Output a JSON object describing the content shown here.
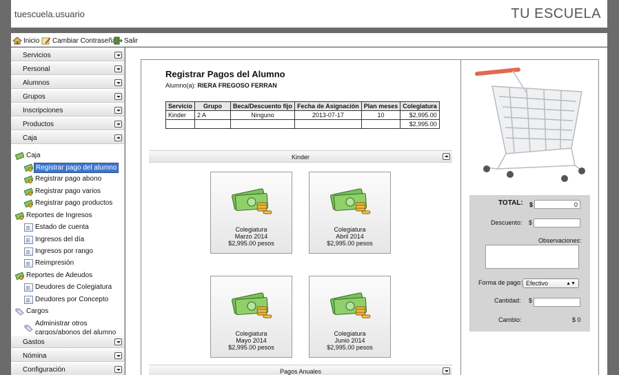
{
  "header": {
    "user": "tuescuela.usuario",
    "brand": "TU ESCUELA"
  },
  "toolbar": {
    "home": "Inicio",
    "change_password": "Cambiar Contraseña",
    "logout": "Salir"
  },
  "sidebar": {
    "sections": [
      "Servicios",
      "Personal",
      "Alumnos",
      "Grupos",
      "Inscripciones",
      "Productos",
      "Caja"
    ],
    "tree": {
      "caja": "Caja",
      "caja_items": [
        "Registrar pago del alumno",
        "Registrar pago abono",
        "Registrar pago varios",
        "Registrar pago productos"
      ],
      "reportes_ingresos": "Reportes de Ingresos",
      "ingresos_items": [
        "Estado de cuenta",
        "Ingresos del día",
        "Ingresos por rango",
        "Reimpresión"
      ],
      "reportes_adeudos": "Reportes de Adeudos",
      "adeudos_items": [
        "Deudores de Colegiatura",
        "Deudores por Concepto"
      ],
      "cargos": "Cargos",
      "cargos_item_line1": "Administrar otros",
      "cargos_item_line2": "cargos/abonos del alumno"
    },
    "bottom_sections": [
      "Gastos",
      "Nómina",
      "Configuración"
    ]
  },
  "panel": {
    "title": "Registrar Pagos del Alumno",
    "student_label": "Alumno(a):",
    "student_name": "RIERA FREGOSO FERRAN",
    "table": {
      "headers": [
        "Servicio",
        "Grupo",
        "Beca/Descuento fijo",
        "Fecha de Asignación",
        "Plan meses",
        "Colegiatura"
      ],
      "row": [
        "Kinder",
        "2 A",
        "Ninguno",
        "2013-07-17",
        "10",
        "$2,995.00"
      ],
      "total": "$2,995.00"
    },
    "section1": "Kinder",
    "section2": "Pagos Anuales",
    "cards": [
      {
        "concept": "Colegiatura",
        "period": "Marzo 2014",
        "amount": "$2,995.00 pesos"
      },
      {
        "concept": "Colegiatura",
        "period": "Abril 2014",
        "amount": "$2,995.00 pesos"
      },
      {
        "concept": "Colegiatura",
        "period": "Mayo 2014",
        "amount": "$2,995.00 pesos"
      },
      {
        "concept": "Colegiatura",
        "period": "Junio 2014",
        "amount": "$2,995.00 pesos"
      }
    ]
  },
  "totals": {
    "total_label": "TOTAL:",
    "total_currency": "$",
    "total_value": "0",
    "discount_label": "Descuento:",
    "discount_currency": "$",
    "discount_value": "",
    "observations_label": "Observaciones:",
    "payment_label": "Forma de pago:",
    "payment_value": "Efectivo",
    "quantity_label": "Cantidad:",
    "quantity_currency": "$",
    "quantity_value": "",
    "change_label": "Cambio:",
    "change_value": "$ 0"
  },
  "colors": {
    "selected": "#3b78d4",
    "cash_green": "#5aa64a",
    "coin_gold": "#e0b030",
    "cart_handle": "#e06a50"
  }
}
